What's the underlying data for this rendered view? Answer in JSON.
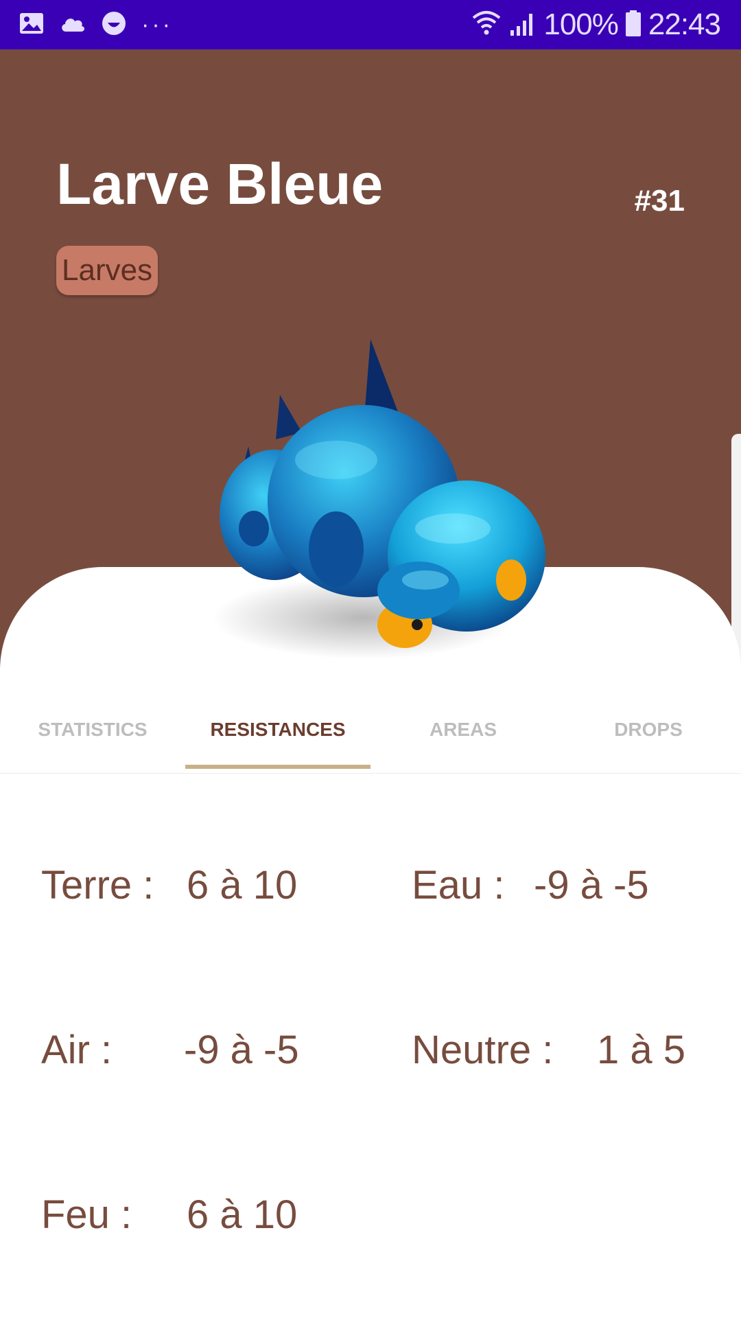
{
  "status_bar": {
    "icons_left": [
      "image-icon",
      "cloud-icon",
      "smiley-icon",
      "more-dots-icon"
    ],
    "more": "···",
    "battery_percent": "100%",
    "time": "22:43"
  },
  "monster": {
    "name": "Larve Bleue",
    "number": "#31",
    "family": "Larves"
  },
  "tabs": [
    {
      "label": "STATISTICS",
      "active": false
    },
    {
      "label": "RESISTANCES",
      "active": true
    },
    {
      "label": "AREAS",
      "active": false
    },
    {
      "label": "DROPS",
      "active": false
    }
  ],
  "resistances": {
    "terre": {
      "label": "Terre :",
      "value": "6 à 10"
    },
    "eau": {
      "label": "Eau :",
      "value": "-9 à -5"
    },
    "air": {
      "label": "Air :",
      "value": "-9 à -5"
    },
    "neutre": {
      "label": "Neutre :",
      "value": "1 à 5"
    },
    "feu": {
      "label": "Feu :",
      "value": "6 à 10"
    }
  },
  "colors": {
    "status_bar": "#3a00b6",
    "header": "#774c3e",
    "chip": "#c77a66",
    "active_tab": "#6b3d2e",
    "tab_indicator": "#c8b089",
    "text": "#774c3e"
  }
}
